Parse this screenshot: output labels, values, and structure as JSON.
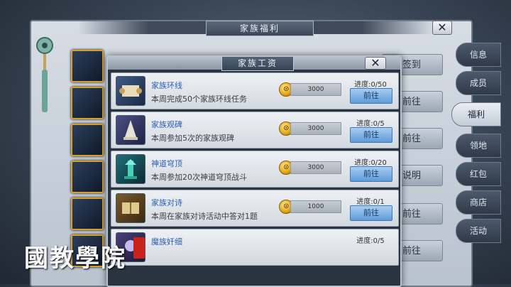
{
  "background_window": {
    "title": "家族福利",
    "buttons": [
      {
        "label": "签到"
      },
      {
        "label": "前往"
      },
      {
        "label": "前往"
      },
      {
        "label": "说明"
      },
      {
        "label": "前往"
      },
      {
        "label": "前往"
      }
    ]
  },
  "side_tabs": [
    {
      "label": "信息",
      "active": false
    },
    {
      "label": "成员",
      "active": false
    },
    {
      "label": "福利",
      "active": true
    },
    {
      "label": "领地",
      "active": false
    },
    {
      "label": "红包",
      "active": false
    },
    {
      "label": "商店",
      "active": false
    },
    {
      "label": "活动",
      "active": false
    }
  ],
  "modal": {
    "title": "家族工资",
    "close_label": "✕",
    "tasks": [
      {
        "name": "家族环线",
        "description": "本周完成50个家族环线任务",
        "reward": "3000",
        "progress": "进度:0/50",
        "button": "前往",
        "icon": "scroll-icon"
      },
      {
        "name": "家族观碑",
        "description": "本周参加5次的家族观碑",
        "reward": "3000",
        "progress": "进度:0/5",
        "button": "前往",
        "icon": "stele-icon"
      },
      {
        "name": "神道穹顶",
        "description": "本周参加20次神道穹顶战斗",
        "reward": "3000",
        "progress": "进度:0/20",
        "button": "前往",
        "icon": "tower-icon"
      },
      {
        "name": "家族对诗",
        "description": "本周在家族对诗活动中答对1题",
        "reward": "1000",
        "progress": "进度:0/1",
        "button": "前往",
        "icon": "poem-book-icon"
      },
      {
        "name": "魔族奸细",
        "description": "",
        "reward": "",
        "progress": "进度:0/5",
        "button": "",
        "icon": "spy-icon"
      }
    ]
  },
  "watermark": {
    "text": "國教學院"
  },
  "colors": {
    "accent_gold": "#d6a02f",
    "task_name_blue": "#2c5fb4",
    "go_button_blue": "#5f9bd8"
  }
}
